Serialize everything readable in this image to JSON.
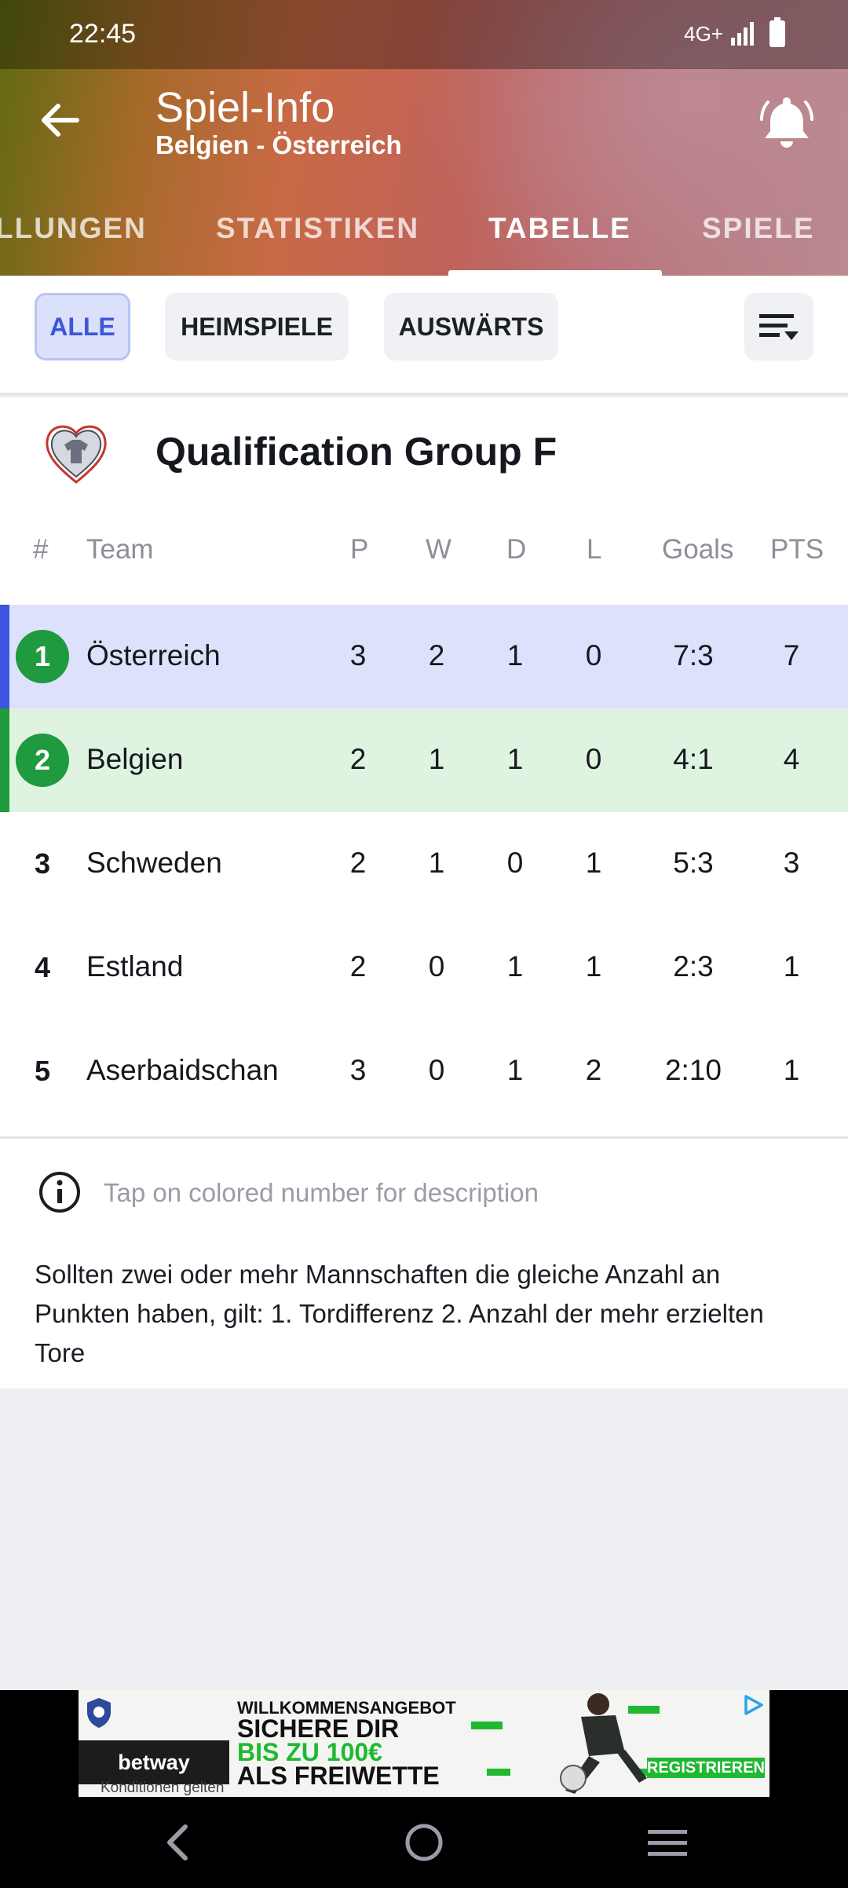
{
  "status_bar": {
    "time": "22:45",
    "network": "4G+"
  },
  "header": {
    "title": "Spiel-Info",
    "subtitle": "Belgien - Österreich"
  },
  "tabs": [
    {
      "label": "LLUNGEN"
    },
    {
      "label": "STATISTIKEN"
    },
    {
      "label": "TABELLE",
      "active": true
    },
    {
      "label": "SPIELE"
    }
  ],
  "filters": [
    {
      "label": "ALLE",
      "active": true
    },
    {
      "label": "HEIMSPIELE"
    },
    {
      "label": "AUSWÄRTS"
    }
  ],
  "competition": {
    "title": "Qualification Group F"
  },
  "columns": {
    "rank": "#",
    "team": "Team",
    "p": "P",
    "w": "W",
    "d": "D",
    "l": "L",
    "goals": "Goals",
    "pts": "PTS"
  },
  "rows": [
    {
      "rank": "1",
      "team": "Österreich",
      "p": "3",
      "w": "2",
      "d": "1",
      "l": "0",
      "goals": "7:3",
      "pts": "7",
      "highlight": "#dde1fb",
      "bar": "#3d55e0",
      "badge": true
    },
    {
      "rank": "2",
      "team": "Belgien",
      "p": "2",
      "w": "1",
      "d": "1",
      "l": "0",
      "goals": "4:1",
      "pts": "4",
      "highlight": "#dff3e1",
      "bar": "#1f9a3e",
      "badge": true
    },
    {
      "rank": "3",
      "team": "Schweden",
      "p": "2",
      "w": "1",
      "d": "0",
      "l": "1",
      "goals": "5:3",
      "pts": "3"
    },
    {
      "rank": "4",
      "team": "Estland",
      "p": "2",
      "w": "0",
      "d": "1",
      "l": "1",
      "goals": "2:3",
      "pts": "1"
    },
    {
      "rank": "5",
      "team": "Aserbaidschan",
      "p": "3",
      "w": "0",
      "d": "1",
      "l": "2",
      "goals": "2:10",
      "pts": "1"
    }
  ],
  "info": {
    "hint": "Tap on colored number for description",
    "rules": "Sollten zwei oder mehr Mannschaften die gleiche Anzahl an Punkten haben, gilt: 1. Tordifferenz 2. Anzahl der mehr erzielten Tore"
  },
  "ad": {
    "brand": "betway",
    "line1": "WILLKOMMENSANGEBOT",
    "line2": "SICHERE DIR",
    "line3": "BIS ZU 100€",
    "line4": "ALS FREIWETTE",
    "cta": "REGISTRIEREN",
    "small": "Konditionen gelten"
  },
  "colors": {
    "accent": "#3d57d8",
    "green": "#1f9a3e"
  }
}
